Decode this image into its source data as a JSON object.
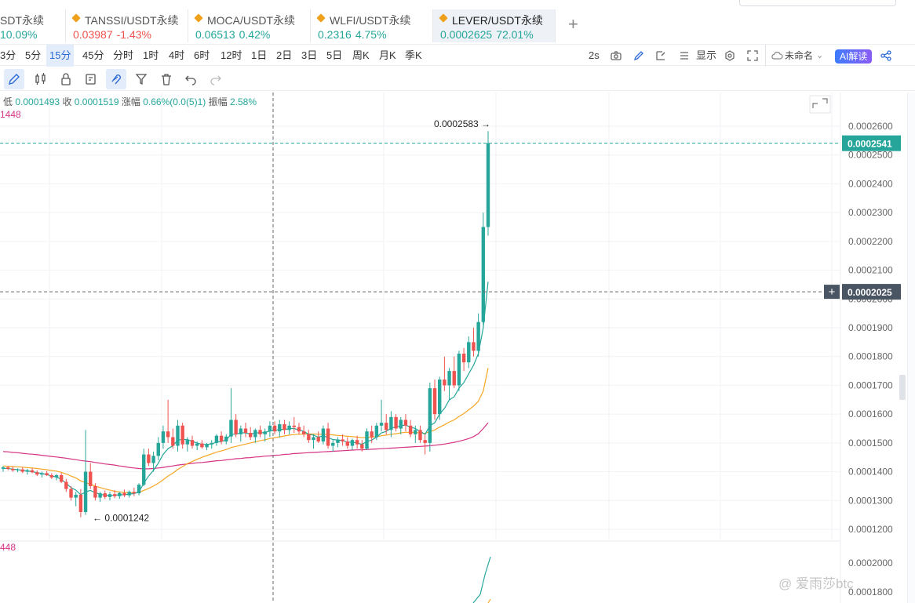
{
  "tickers": [
    {
      "name": "SDT永续",
      "price": "",
      "change": "10.09%",
      "dir": "up",
      "diamond": false
    },
    {
      "name": "TANSSI/USDT永续",
      "price": "0.03987",
      "change": "-1.43%",
      "dir": "down",
      "diamond": true
    },
    {
      "name": "MOCA/USDT永续",
      "price": "0.06513",
      "change": "0.42%",
      "dir": "up",
      "diamond": true
    },
    {
      "name": "WLFI/USDT永续",
      "price": "0.2316",
      "change": "4.75%",
      "dir": "up",
      "diamond": true
    },
    {
      "name": "LEVER/USDT永续",
      "price": "0.0002625",
      "change": "72.01%",
      "dir": "up",
      "diamond": true,
      "active": true
    }
  ],
  "add_tab": "+",
  "intervals": [
    "3分",
    "5分",
    "15分",
    "45分",
    "分时",
    "1时",
    "4时",
    "6时",
    "12时",
    "1日",
    "2日",
    "3日",
    "5日",
    "周K",
    "月K",
    "季K"
  ],
  "selected_interval": "15分",
  "toolbar_right": {
    "refresh": "2s",
    "display": "显示",
    "layout_name": "未命名",
    "ai": "AI解读"
  },
  "info": {
    "low_label": "低",
    "low": "0.0001493",
    "close_label": "收",
    "close": "0.0001519",
    "change_label": "涨幅",
    "change": "0.66%(0.0(5)1)",
    "amp_label": "振幅",
    "amp": "2.58%"
  },
  "ma_label_top": "1448",
  "ma_label_bottom": "448",
  "watermark": "@ 爱雨莎btc",
  "colors": {
    "up": "#26a69a",
    "down": "#ef5350",
    "ma_fast": "#26a69a",
    "ma_mid": "#f5a623",
    "ma_slow": "#d63384"
  },
  "chart_data": {
    "type": "candlestick",
    "y_ticks": [
      "0.0002600",
      "0.0002500",
      "0.0002400",
      "0.0002300",
      "0.0002200",
      "0.0002100",
      "0.0002000",
      "0.0001900",
      "0.0001800",
      "0.0001700",
      "0.0001600",
      "0.0001500",
      "0.0001400",
      "0.0001300",
      "0.0001200"
    ],
    "ylim": [
      0.000115,
      0.000262
    ],
    "sub_y_ticks": [
      "0.0002000",
      "0.0001800"
    ],
    "last_price_label": "0.0002541",
    "last_price": 0.0002541,
    "crosshair_label": "0.0002025",
    "crosshair_price": 0.0002025,
    "high_label": "0.0002583",
    "high": 0.0002583,
    "low_label": "0.0001242",
    "low": 0.0001242,
    "candles": [
      [
        0.000141,
        0.000142,
        0.00014,
        0.0001415
      ],
      [
        0.0001415,
        0.000142,
        0.0001405,
        0.000141
      ],
      [
        0.000141,
        0.0001418,
        0.00014,
        0.0001405
      ],
      [
        0.0001405,
        0.0001412,
        0.0001398,
        0.0001408
      ],
      [
        0.0001408,
        0.0001415,
        0.0001395,
        0.00014
      ],
      [
        0.00014,
        0.000141,
        0.000139,
        0.0001405
      ],
      [
        0.0001405,
        0.0001412,
        0.0001395,
        0.0001398
      ],
      [
        0.0001398,
        0.0001405,
        0.0001385,
        0.000139
      ],
      [
        0.000139,
        0.00014,
        0.000138,
        0.0001395
      ],
      [
        0.0001395,
        0.0001402,
        0.0001385,
        0.0001388
      ],
      [
        0.0001388,
        0.0001395,
        0.0001375,
        0.000138
      ],
      [
        0.000138,
        0.0001392,
        0.000137,
        0.0001388
      ],
      [
        0.0001388,
        0.0001396,
        0.000136,
        0.0001365
      ],
      [
        0.0001365,
        0.0001375,
        0.000133,
        0.000134
      ],
      [
        0.000134,
        0.000135,
        0.00013,
        0.000131
      ],
      [
        0.000131,
        0.000133,
        0.000128,
        0.000132
      ],
      [
        0.000132,
        0.000134,
        0.0001242,
        0.000126
      ],
      [
        0.000126,
        0.0001545,
        0.000125,
        0.00014
      ],
      [
        0.00014,
        0.000143,
        0.000134,
        0.000135
      ],
      [
        0.000135,
        0.000136,
        0.00013,
        0.000131
      ],
      [
        0.000131,
        0.000133,
        0.0001295,
        0.0001325
      ],
      [
        0.0001325,
        0.0001335,
        0.0001305,
        0.0001312
      ],
      [
        0.0001312,
        0.000133,
        0.00013,
        0.0001322
      ],
      [
        0.0001322,
        0.0001336,
        0.0001308,
        0.0001315
      ],
      [
        0.0001315,
        0.000133,
        0.0001306,
        0.0001326
      ],
      [
        0.0001326,
        0.0001338,
        0.0001312,
        0.0001318
      ],
      [
        0.0001318,
        0.0001335,
        0.000131,
        0.000133
      ],
      [
        0.000133,
        0.0001345,
        0.0001315,
        0.0001325
      ],
      [
        0.0001325,
        0.000136,
        0.0001318,
        0.0001355
      ],
      [
        0.0001355,
        0.000148,
        0.000135,
        0.000146
      ],
      [
        0.000146,
        0.000148,
        0.000142,
        0.000143
      ],
      [
        0.000143,
        0.000147,
        0.00014,
        0.0001455
      ],
      [
        0.0001455,
        0.000152,
        0.000144,
        0.00015
      ],
      [
        0.00015,
        0.000156,
        0.000148,
        0.000154
      ],
      [
        0.000154,
        0.000165,
        0.00015,
        0.000152
      ],
      [
        0.000152,
        0.000155,
        0.000148,
        0.000149
      ],
      [
        0.000149,
        0.000158,
        0.000147,
        0.000156
      ],
      [
        0.000156,
        0.000157,
        0.000148,
        0.0001495
      ],
      [
        0.0001495,
        0.000152,
        0.000147,
        0.000151
      ],
      [
        0.000151,
        0.0001525,
        0.000148,
        0.000149
      ],
      [
        0.000149,
        0.0001505,
        0.0001475,
        0.0001498
      ],
      [
        0.0001498,
        0.000151,
        0.000148,
        0.0001485
      ],
      [
        0.0001485,
        0.00015,
        0.0001475,
        0.0001495
      ],
      [
        0.0001495,
        0.000151,
        0.000148,
        0.00015
      ],
      [
        0.00015,
        0.000153,
        0.000149,
        0.0001525
      ],
      [
        0.0001525,
        0.000154,
        0.0001495,
        0.0001505
      ],
      [
        0.0001505,
        0.000153,
        0.0001495,
        0.0001522
      ],
      [
        0.0001522,
        0.000169,
        0.00015,
        0.000158
      ],
      [
        0.000158,
        0.00016,
        0.000152,
        0.000153
      ],
      [
        0.000153,
        0.000156,
        0.0001505,
        0.000155
      ],
      [
        0.000155,
        0.000157,
        0.000152,
        0.0001535
      ],
      [
        0.0001535,
        0.0001555,
        0.000151,
        0.000152
      ],
      [
        0.000152,
        0.000155,
        0.00015,
        0.0001545
      ],
      [
        0.0001545,
        0.000156,
        0.000152,
        0.000153
      ],
      [
        0.000153,
        0.000155,
        0.0001505,
        0.000154
      ],
      [
        0.000154,
        0.0001575,
        0.000152,
        0.000156
      ],
      [
        0.000156,
        0.0001575,
        0.000153,
        0.000154
      ],
      [
        0.000154,
        0.000158,
        0.000152,
        0.0001565
      ],
      [
        0.0001565,
        0.000158,
        0.000153,
        0.0001545
      ],
      [
        0.0001545,
        0.0001575,
        0.000153,
        0.000156
      ],
      [
        0.000156,
        0.000159,
        0.0001535,
        0.0001555
      ],
      [
        0.0001555,
        0.000157,
        0.000153,
        0.000154
      ],
      [
        0.000154,
        0.000156,
        0.000152,
        0.000153
      ],
      [
        0.000153,
        0.0001545,
        0.00015,
        0.000151
      ],
      [
        0.000151,
        0.000153,
        0.000148,
        0.000152
      ],
      [
        0.000152,
        0.000154,
        0.00015,
        0.0001505
      ],
      [
        0.0001505,
        0.000156,
        0.0001495,
        0.000155
      ],
      [
        0.000155,
        0.000157,
        0.000148,
        0.000149
      ],
      [
        0.000149,
        0.000151,
        0.000147,
        0.00015
      ],
      [
        0.00015,
        0.000152,
        0.0001485,
        0.0001512
      ],
      [
        0.0001512,
        0.000153,
        0.000149,
        0.0001505
      ],
      [
        0.0001505,
        0.000152,
        0.000148,
        0.000149
      ],
      [
        0.000149,
        0.0001515,
        0.0001475,
        0.000151
      ],
      [
        0.000151,
        0.0001525,
        0.000148,
        0.0001495
      ],
      [
        0.0001495,
        0.000151,
        0.000147,
        0.000148
      ],
      [
        0.000148,
        0.000155,
        0.0001475,
        0.000154
      ],
      [
        0.000154,
        0.000156,
        0.00015,
        0.000152
      ],
      [
        0.000152,
        0.000157,
        0.000151,
        0.000156
      ],
      [
        0.000156,
        0.000165,
        0.000154,
        0.000157
      ],
      [
        0.000157,
        0.00016,
        0.000153,
        0.0001545
      ],
      [
        0.0001545,
        0.000161,
        0.000152,
        0.000159
      ],
      [
        0.000159,
        0.00016,
        0.000154,
        0.000155
      ],
      [
        0.000155,
        0.000159,
        0.000153,
        0.000158
      ],
      [
        0.000158,
        0.00016,
        0.000154,
        0.000156
      ],
      [
        0.000156,
        0.000158,
        0.000152,
        0.000153
      ],
      [
        0.000153,
        0.000156,
        0.00015,
        0.0001545
      ],
      [
        0.0001545,
        0.000156,
        0.00015,
        0.000151
      ],
      [
        0.000151,
        0.000153,
        0.000146,
        0.00015
      ],
      [
        0.00015,
        0.000171,
        0.000147,
        0.000169
      ],
      [
        0.000169,
        0.000172,
        0.000158,
        0.00016
      ],
      [
        0.00016,
        0.000173,
        0.000158,
        0.000172
      ],
      [
        0.000172,
        0.00018,
        0.000168,
        0.00017
      ],
      [
        0.00017,
        0.000176,
        0.000165,
        0.000175
      ],
      [
        0.000175,
        0.00018,
        0.000169,
        0.00017
      ],
      [
        0.00017,
        0.000182,
        0.000168,
        0.000181
      ],
      [
        0.000181,
        0.000183,
        0.000175,
        0.000178
      ],
      [
        0.000178,
        0.000187,
        0.000176,
        0.000185
      ],
      [
        0.000185,
        0.00019,
        0.00018,
        0.000182
      ],
      [
        0.000182,
        0.000195,
        0.00018,
        0.000192
      ],
      [
        0.000192,
        0.00023,
        0.000191,
        0.000225
      ],
      [
        0.000225,
        0.0002583,
        0.000222,
        0.0002541
      ]
    ],
    "ma_fast": [
      0.0001412,
      0.0001411,
      0.0001409,
      0.0001407,
      0.0001405,
      0.0001403,
      0.00014,
      0.0001397,
      0.0001394,
      0.000139,
      0.0001385,
      0.0001382,
      0.0001373,
      0.000136,
      0.0001345,
      0.0001336,
      0.000132,
      0.000133,
      0.0001335,
      0.0001327,
      0.0001322,
      0.0001318,
      0.0001318,
      0.0001318,
      0.000132,
      0.000132,
      0.0001322,
      0.0001324,
      0.000133,
      0.000136,
      0.0001385,
      0.0001405,
      0.000143,
      0.000146,
      0.000148,
      0.000149,
      0.000151,
      0.0001512,
      0.0001512,
      0.0001505,
      0.00015,
      0.0001495,
      0.0001495,
      0.0001496,
      0.0001503,
      0.0001505,
      0.000151,
      0.000153,
      0.000153,
      0.0001535,
      0.0001535,
      0.000153,
      0.0001535,
      0.0001535,
      0.0001536,
      0.0001542,
      0.0001542,
      0.0001548,
      0.0001546,
      0.000155,
      0.000155,
      0.0001545,
      0.000154,
      0.000153,
      0.0001527,
      0.000152,
      0.0001525,
      0.0001518,
      0.0001512,
      0.000151,
      0.0001508,
      0.0001503,
      0.0001503,
      0.00015,
      0.0001495,
      0.0001505,
      0.000151,
      0.000152,
      0.0001535,
      0.000154,
      0.0001552,
      0.0001555,
      0.000156,
      0.0001562,
      0.0001555,
      0.000155,
      0.000154,
      0.000153,
      0.000156,
      0.000157,
      0.00016,
      0.000162,
      0.000165,
      0.000166,
      0.000169,
      0.000171,
      0.000174,
      0.000177,
      0.000181,
      0.00019,
      0.000206
    ],
    "ma_mid": [
      0.000142,
      0.0001419,
      0.0001418,
      0.0001417,
      0.0001416,
      0.0001414,
      0.0001413,
      0.0001411,
      0.0001409,
      0.0001407,
      0.0001404,
      0.0001402,
      0.0001398,
      0.0001392,
      0.0001385,
      0.0001378,
      0.0001368,
      0.0001362,
      0.0001357,
      0.000135,
      0.0001345,
      0.000134,
      0.0001336,
      0.0001332,
      0.000133,
      0.0001328,
      0.0001327,
      0.0001326,
      0.0001328,
      0.0001335,
      0.0001342,
      0.000135,
      0.000136,
      0.0001372,
      0.0001385,
      0.0001395,
      0.0001408,
      0.0001418,
      0.0001428,
      0.0001436,
      0.0001443,
      0.000145,
      0.0001456,
      0.0001462,
      0.0001468,
      0.0001472,
      0.0001477,
      0.0001484,
      0.0001488,
      0.0001492,
      0.0001496,
      0.00015,
      0.0001504,
      0.0001508,
      0.0001511,
      0.0001515,
      0.0001518,
      0.0001521,
      0.0001524,
      0.0001527,
      0.0001529,
      0.000153,
      0.0001531,
      0.0001531,
      0.0001531,
      0.000153,
      0.000153,
      0.0001529,
      0.0001528,
      0.0001526,
      0.0001525,
      0.0001523,
      0.0001522,
      0.000152,
      0.0001518,
      0.0001519,
      0.000152,
      0.0001522,
      0.0001525,
      0.0001527,
      0.000153,
      0.0001532,
      0.0001535,
      0.0001537,
      0.0001537,
      0.0001536,
      0.0001535,
      0.0001533,
      0.000154,
      0.0001545,
      0.0001555,
      0.0001563,
      0.0001573,
      0.000158,
      0.0001592,
      0.0001602,
      0.0001615,
      0.0001628,
      0.0001645,
      0.000168,
      0.000176
    ],
    "ma_slow": [
      0.000147,
      0.0001469,
      0.0001467,
      0.0001466,
      0.0001464,
      0.0001462,
      0.0001461,
      0.0001459,
      0.0001457,
      0.0001455,
      0.0001453,
      0.0001451,
      0.0001449,
      0.0001447,
      0.0001444,
      0.0001442,
      0.0001439,
      0.0001437,
      0.0001435,
      0.0001432,
      0.000143,
      0.0001427,
      0.0001425,
      0.0001423,
      0.000142,
      0.0001418,
      0.0001415,
      0.0001413,
      0.0001411,
      0.000141,
      0.000141,
      0.0001411,
      0.0001413,
      0.0001415,
      0.0001418,
      0.000142,
      0.0001423,
      0.0001425,
      0.0001427,
      0.0001429,
      0.0001431,
      0.0001432,
      0.0001434,
      0.0001436,
      0.0001438,
      0.0001439,
      0.0001441,
      0.0001443,
      0.0001445,
      0.0001446,
      0.0001448,
      0.0001449,
      0.0001451,
      0.0001452,
      0.0001454,
      0.0001455,
      0.0001457,
      0.0001458,
      0.000146,
      0.0001461,
      0.0001463,
      0.0001464,
      0.0001465,
      0.0001466,
      0.0001467,
      0.0001468,
      0.0001469,
      0.000147,
      0.0001471,
      0.0001472,
      0.0001473,
      0.0001474,
      0.0001475,
      0.0001476,
      0.0001476,
      0.0001477,
      0.0001478,
      0.0001479,
      0.000148,
      0.0001481,
      0.0001482,
      0.0001483,
      0.0001484,
      0.0001485,
      0.0001486,
      0.0001487,
      0.0001488,
      0.0001489,
      0.000149,
      0.0001492,
      0.0001494,
      0.0001496,
      0.0001499,
      0.0001502,
      0.0001506,
      0.000151,
      0.0001515,
      0.0001522,
      0.0001532,
      0.000155,
      0.000157
    ]
  }
}
